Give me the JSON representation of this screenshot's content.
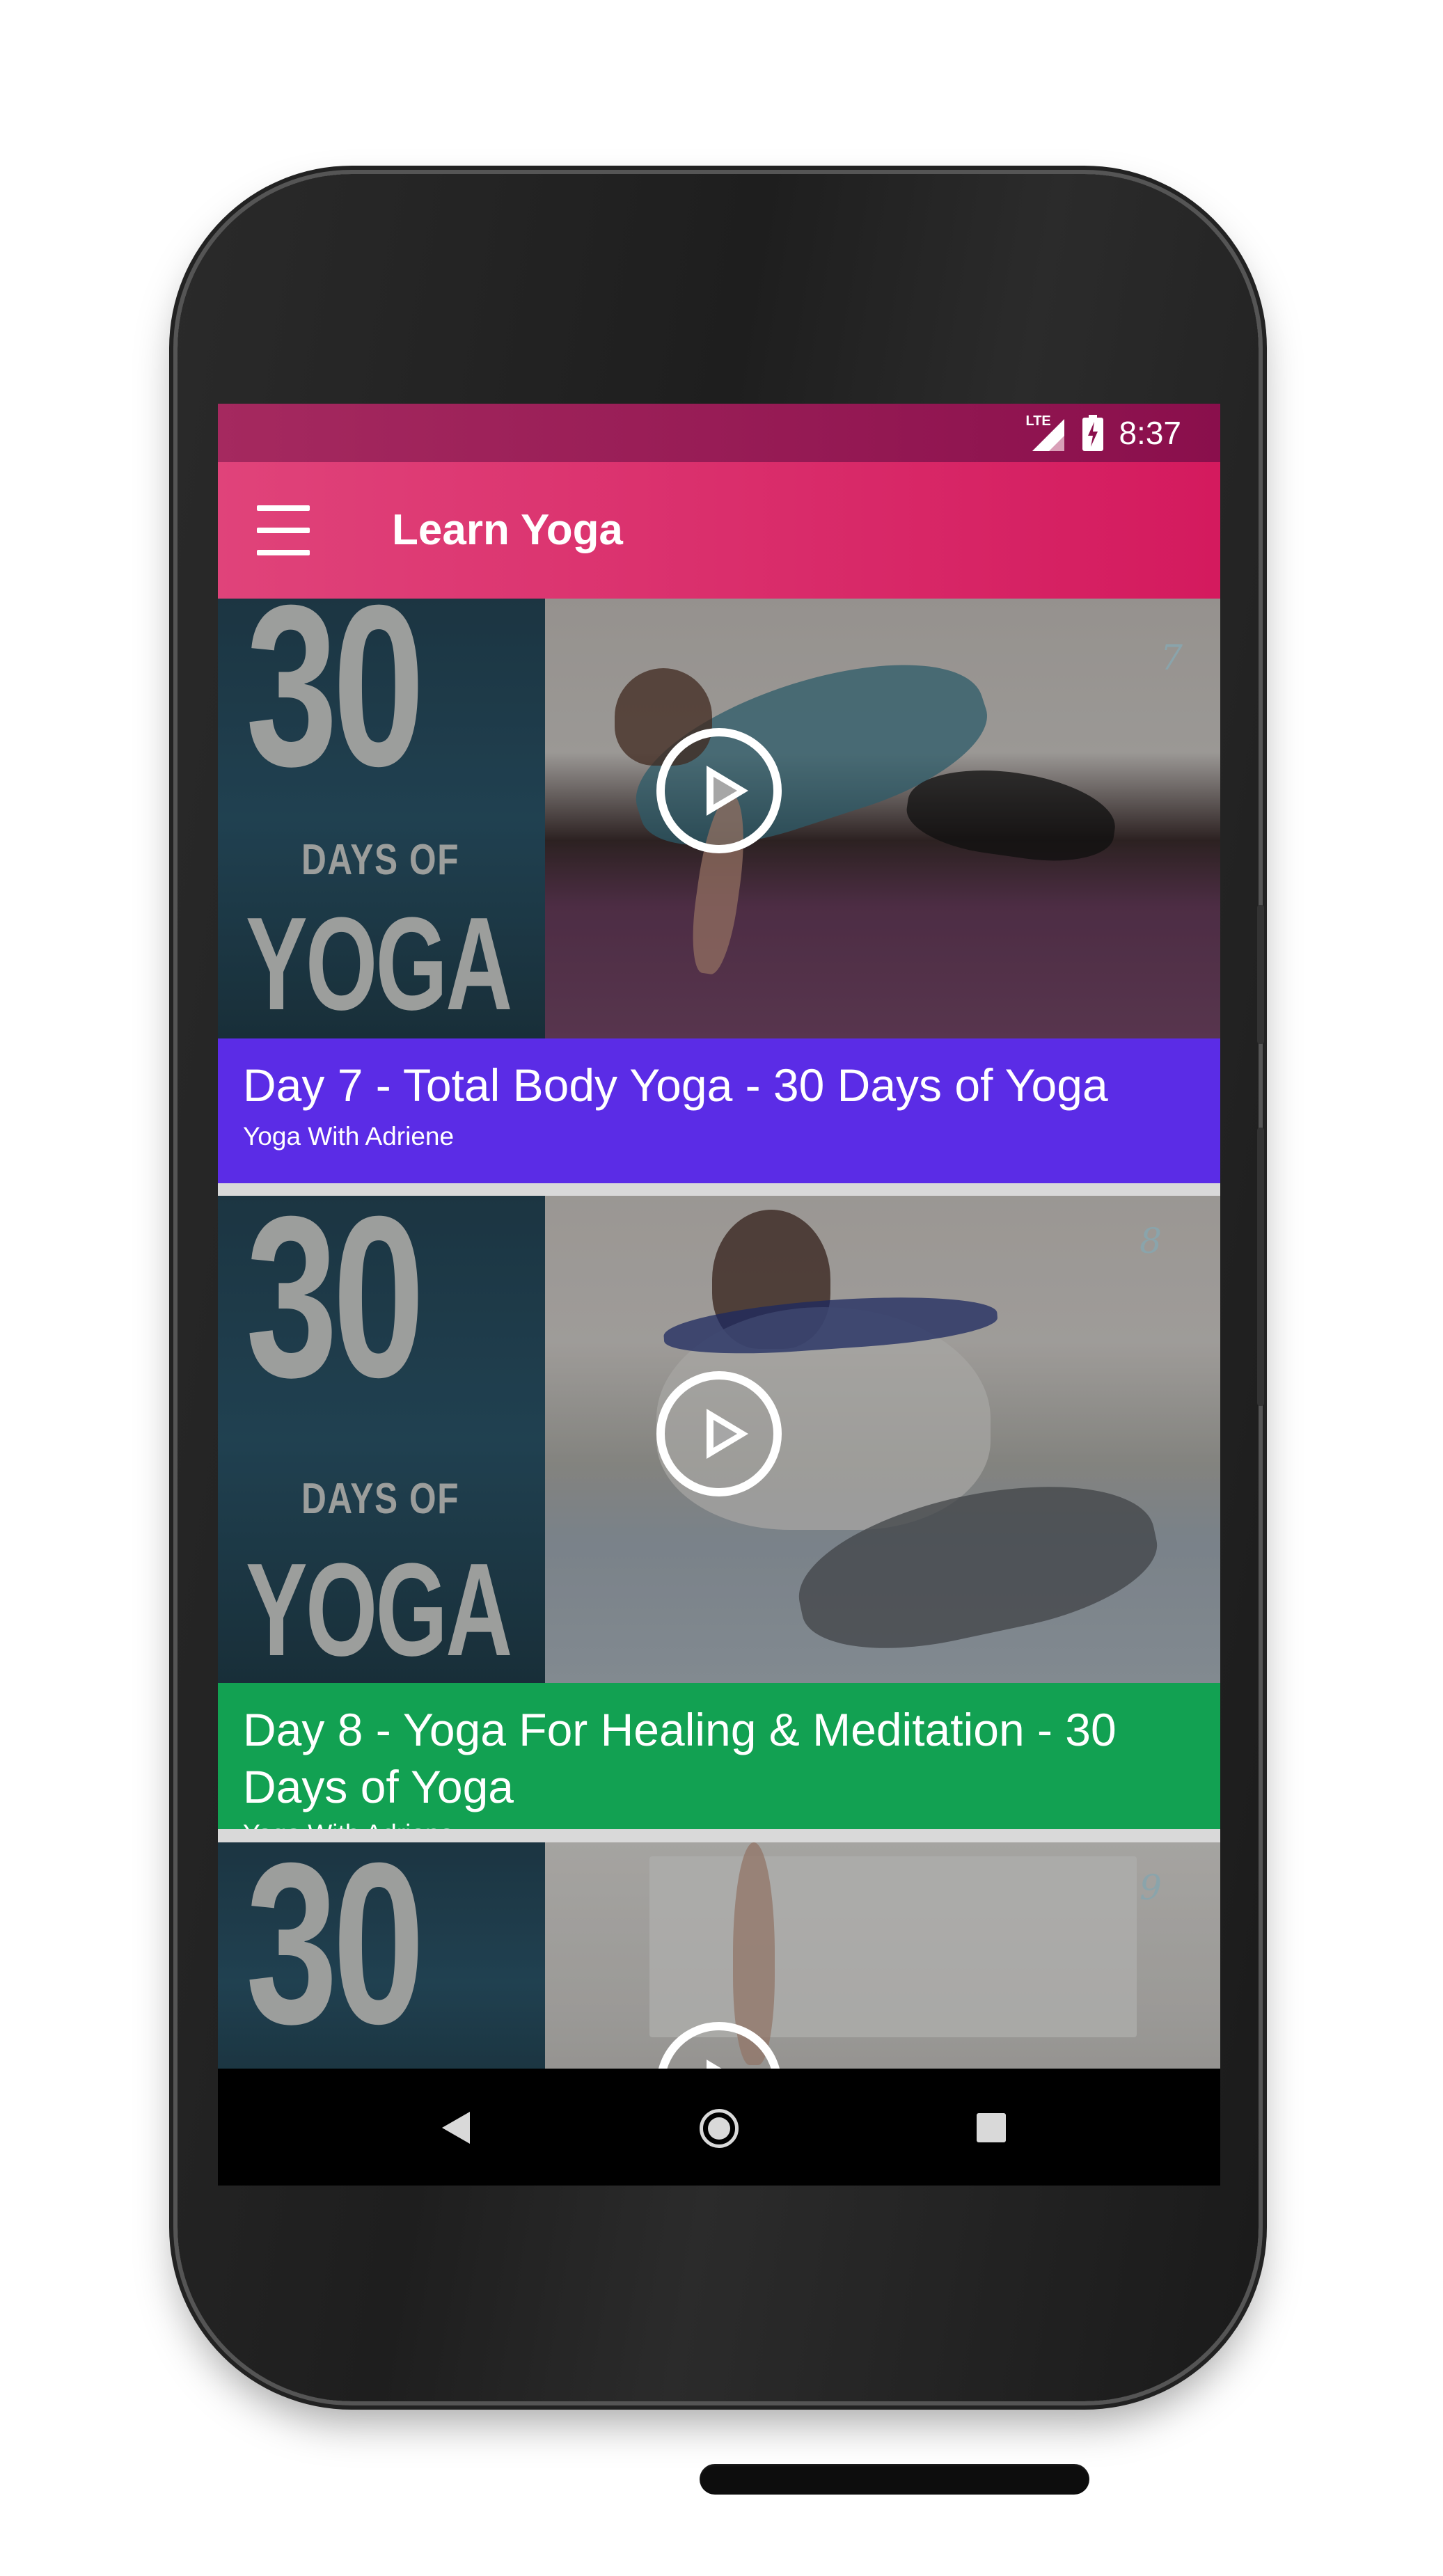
{
  "status_bar": {
    "network": "LTE",
    "time": "8:37",
    "signal_icon": "signal-icon",
    "battery_icon": "battery-charging-icon"
  },
  "app_bar": {
    "title": "Learn Yoga",
    "menu_icon": "hamburger-menu-icon"
  },
  "videos": [
    {
      "title": "Day 7 - Total Body Yoga - 30 Days of Yoga",
      "author": "Yoga With Adriene",
      "thumbnail_big": "30",
      "thumbnail_days": "DAYS OF",
      "thumbnail_yoga": "YOGA",
      "thumbnail_heart": "7",
      "caption_color": "#5b2ce6"
    },
    {
      "title": "Day 8 - Yoga For Healing & Meditation - 30 Days of Yoga",
      "author": "Yoga With Adriene",
      "thumbnail_big": "30",
      "thumbnail_days": "DAYS OF",
      "thumbnail_yoga": "YOGA",
      "thumbnail_heart": "8",
      "caption_color": "#12a152"
    },
    {
      "thumbnail_big": "30",
      "thumbnail_heart": "9"
    }
  ],
  "nav": {
    "back_icon": "back-icon",
    "home_icon": "home-icon",
    "recents_icon": "recents-icon"
  },
  "colors": {
    "app_bar": "#d81b60",
    "status_bar": "#880e4f"
  }
}
